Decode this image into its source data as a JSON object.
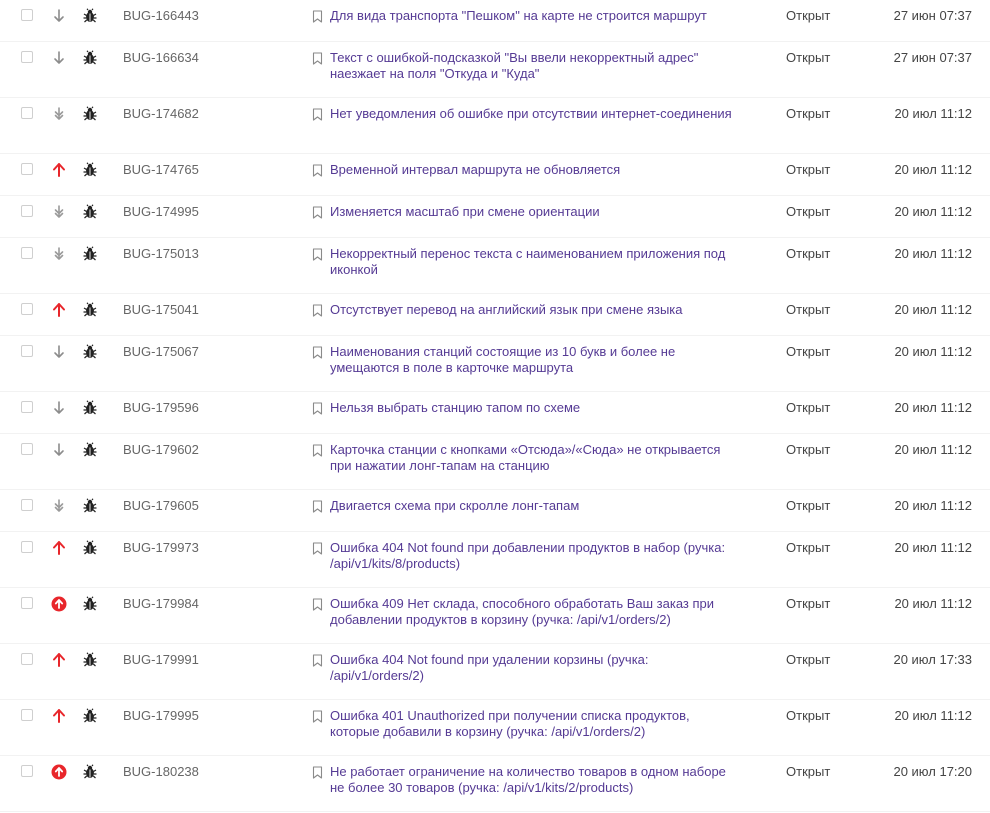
{
  "issues": [
    {
      "checked": false,
      "priority": "low-arrow-icon",
      "key": "BUG-166443",
      "title": "Для вида транспорта \"Пешком\" на карте не строится маршрут",
      "status": "Открыт",
      "date": "27 июн 07:37",
      "lines": 1
    },
    {
      "checked": false,
      "priority": "low-arrow-icon",
      "key": "BUG-166634",
      "title": "Текст с ошибкой-подсказкой \"Вы ввели некорректный адрес\" наезжает на поля \"Откуда и \"Куда\"",
      "status": "Открыт",
      "date": "27 июн 07:37",
      "lines": 2
    },
    {
      "checked": false,
      "priority": "trivial-arrow-icon",
      "key": "BUG-174682",
      "title": "Нет уведомления об ошибке при отсутствии интернет-соединения",
      "status": "Открыт",
      "date": "20 июл 11:12",
      "lines": 2
    },
    {
      "checked": false,
      "priority": "high-arrow-icon",
      "key": "BUG-174765",
      "title": "Временной интервал маршрута не обновляется",
      "status": "Открыт",
      "date": "20 июл 11:12",
      "lines": 1
    },
    {
      "checked": false,
      "priority": "trivial-arrow-icon",
      "key": "BUG-174995",
      "title": "Изменяется масштаб при смене ориентации",
      "status": "Открыт",
      "date": "20 июл 11:12",
      "lines": 1
    },
    {
      "checked": false,
      "priority": "trivial-arrow-icon",
      "key": "BUG-175013",
      "title": "Некорректный перенос текста с наименованием приложения под иконкой",
      "status": "Открыт",
      "date": "20 июл 11:12",
      "lines": 2
    },
    {
      "checked": false,
      "priority": "high-arrow-icon",
      "key": "BUG-175041",
      "title": "Отсутствует перевод на английский язык при смене языка",
      "status": "Открыт",
      "date": "20 июл 11:12",
      "lines": 1
    },
    {
      "checked": false,
      "priority": "low-arrow-icon",
      "key": "BUG-175067",
      "title": "Наименования станций состоящие из 10 букв и более не умещаются в поле в карточке маршрута",
      "status": "Открыт",
      "date": "20 июл 11:12",
      "lines": 2
    },
    {
      "checked": false,
      "priority": "low-arrow-icon",
      "key": "BUG-179596",
      "title": "Нельзя выбрать станцию тапом по схеме",
      "status": "Открыт",
      "date": "20 июл 11:12",
      "lines": 1
    },
    {
      "checked": false,
      "priority": "low-arrow-icon",
      "key": "BUG-179602",
      "title": "Карточка станции с кнопками «Отсюда»/«Сюда» не открывается при нажатии лонг-тапам на станцию",
      "status": "Открыт",
      "date": "20 июл 11:12",
      "lines": 2
    },
    {
      "checked": false,
      "priority": "trivial-arrow-icon",
      "key": "BUG-179605",
      "title": "Двигается схема при скролле лонг-тапам",
      "status": "Открыт",
      "date": "20 июл 11:12",
      "lines": 1
    },
    {
      "checked": false,
      "priority": "high-arrow-icon",
      "key": "BUG-179973",
      "title": "Ошибка 404 Not found при добавлении продуктов в набор (ручка: /api/v1/kits/8/products)",
      "status": "Открыт",
      "date": "20 июл 11:12",
      "lines": 2
    },
    {
      "checked": false,
      "priority": "critical-circle-icon",
      "key": "BUG-179984",
      "title": "Ошибка 409 Нет склада, способного обработать Ваш заказ при добавлении продуктов в корзину (ручка: /api/v1/orders/2)",
      "status": "Открыт",
      "date": "20 июл 11:12",
      "lines": 2
    },
    {
      "checked": false,
      "priority": "high-arrow-icon",
      "key": "BUG-179991",
      "title": "Ошибка 404 Not found при удалении корзины (ручка: /api/v1/orders/2)",
      "status": "Открыт",
      "date": "20 июл 17:33",
      "lines": 2
    },
    {
      "checked": false,
      "priority": "high-arrow-icon",
      "key": "BUG-179995",
      "title": "Ошибка 401 Unauthorized при получении списка продуктов, которые добавили в корзину (ручка: /api/v1/orders/2)",
      "status": "Открыт",
      "date": "20 июл 11:12",
      "lines": 2
    },
    {
      "checked": false,
      "priority": "critical-circle-icon",
      "key": "BUG-180238",
      "title": "Не работает ограничение на количество товаров в одном наборе не более 30 товаров (ручка: /api/v1/kits/2/products)",
      "status": "Открыт",
      "date": "20 июл 17:20",
      "lines": 2
    }
  ],
  "colors": {
    "title": "#553a94",
    "high": "#e8262b",
    "low": "#8c8c8c",
    "trivial": "#9a9a9a"
  }
}
